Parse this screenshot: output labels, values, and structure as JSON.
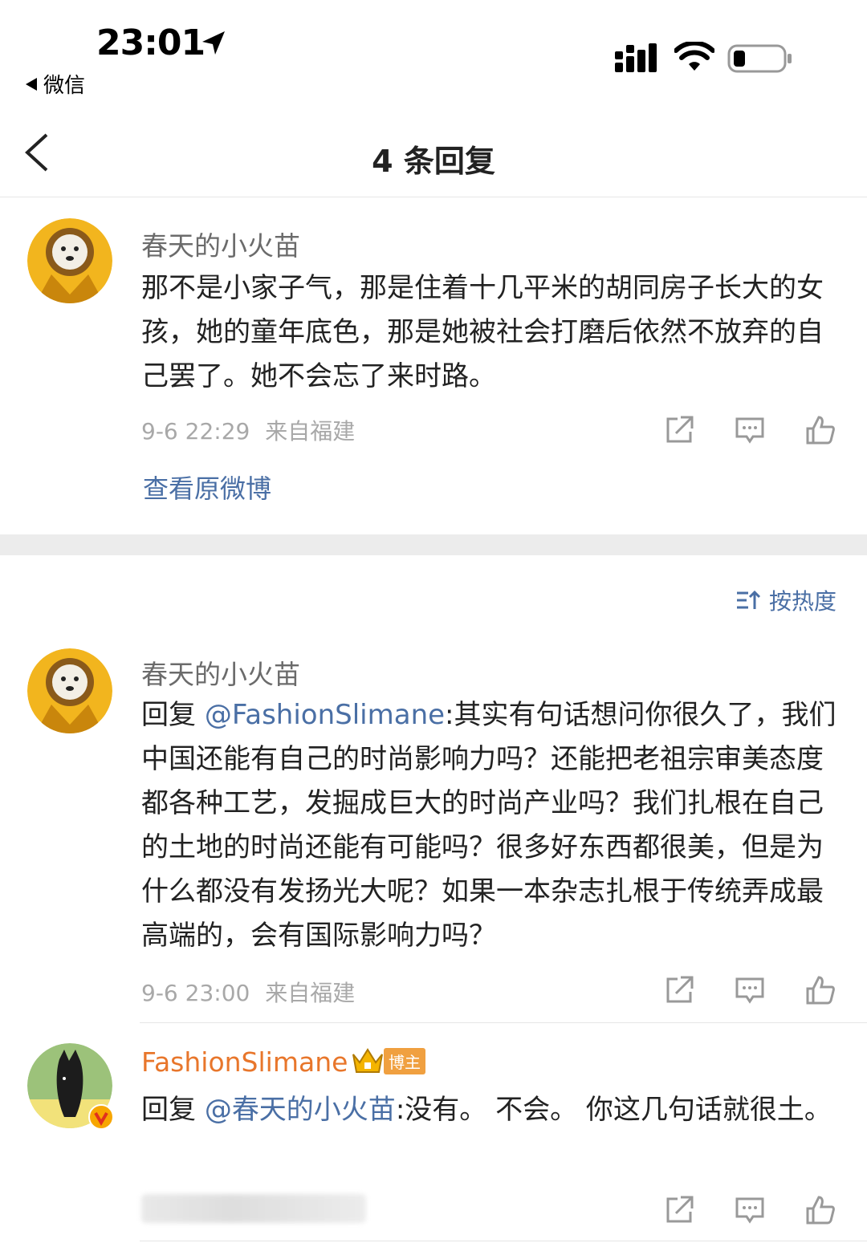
{
  "status_bar": {
    "time": "23:01",
    "back_app": "微信"
  },
  "nav": {
    "title": "4 条回复"
  },
  "original_comment": {
    "username": "春天的小火苗",
    "text": "那不是小家子气，那是住着十几平米的胡同房子长大的女孩，她的童年底色，那是她被社会打磨后依然不放弃的自己罢了。她不会忘了来时路。",
    "time": "9-6 22:29",
    "location": "来自福建",
    "view_original": "查看原微博"
  },
  "sort_label": "按热度",
  "replies": [
    {
      "username": "春天的小火苗",
      "reply_prefix": "回复 ",
      "mention": "@FashionSlimane",
      "text": ":其实有句话想问你很久了，我们中国还能有自己的时尚影响力吗？还能把老祖宗审美态度都各种工艺，发掘成巨大的时尚产业吗？我们扎根在自己的土地的时尚还能有可能吗？很多好东西都很美，但是为什么都没有发扬光大呢？如果一本杂志扎根于传统弄成最高端的，会有国际影响力吗？",
      "time": "9-6 23:00",
      "location": "来自福建"
    },
    {
      "username": "FashionSlimane",
      "badge": "博主",
      "reply_prefix": "回复 ",
      "mention": "@春天的小火苗",
      "text": ":没有。 不会。 你这几句话就很土。"
    }
  ],
  "colors": {
    "link": "#4a6fa5",
    "meta_gray": "#a8a8a8",
    "username_gray": "#6b6b6b",
    "blogger_orange": "#e8762b",
    "separator": "#ececec"
  },
  "icons": [
    "location-arrow-icon",
    "signal-icon",
    "wifi-icon",
    "battery-icon",
    "back-chevron-icon",
    "share-icon",
    "comment-icon",
    "like-icon",
    "sort-icon",
    "crown-icon",
    "verified-icon"
  ]
}
